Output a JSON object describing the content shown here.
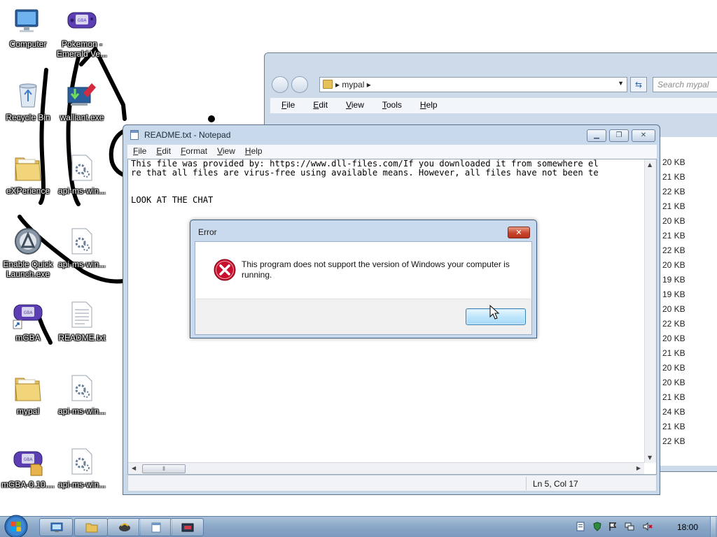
{
  "desktop": {
    "icons": [
      {
        "label": "Computer",
        "icon": "computer-icon"
      },
      {
        "label": "Pokemon - Emerald Ve...",
        "icon": "gba-rom-icon"
      },
      {
        "label": "Recycle Bin",
        "icon": "recycle-bin-icon"
      },
      {
        "label": "walliant.exe",
        "icon": "installer-icon"
      },
      {
        "label": "eXPerience",
        "icon": "folder-icon"
      },
      {
        "label": "api-ms-win...",
        "icon": "dll-file-icon"
      },
      {
        "label": "Enable Quick Launch.exe",
        "icon": "quick-launch-icon"
      },
      {
        "label": "api-ms-win...",
        "icon": "dll-file-icon"
      },
      {
        "label": "mGBA",
        "icon": "mgba-shortcut-icon"
      },
      {
        "label": "README.txt",
        "icon": "text-file-icon"
      },
      {
        "label": "mypal",
        "icon": "folder-icon"
      },
      {
        "label": "api-ms-win...",
        "icon": "dll-file-icon"
      },
      {
        "label": "mGBA-0.10....",
        "icon": "mgba-archive-icon"
      },
      {
        "label": "api-ms-win...",
        "icon": "dll-file-icon"
      }
    ]
  },
  "explorer": {
    "breadcrumb": "mypal",
    "search_placeholder": "Search mypal",
    "menu": [
      "File",
      "Edit",
      "View",
      "Tools",
      "Help"
    ],
    "sizes": [
      "20 KB",
      "21 KB",
      "22 KB",
      "21 KB",
      "20 KB",
      "21 KB",
      "22 KB",
      "20 KB",
      "19 KB",
      "19 KB",
      "20 KB",
      "22 KB",
      "20 KB",
      "21 KB",
      "20 KB",
      "20 KB",
      "21 KB",
      "24 KB",
      "21 KB",
      "22 KB"
    ]
  },
  "notepad": {
    "title": "README.txt - Notepad",
    "menu": [
      "File",
      "Edit",
      "Format",
      "View",
      "Help"
    ],
    "text_line1": "This file was provided by: https://www.dll-files.com/If you downloaded it from somewhere el",
    "text_line2": "re that all files are virus-free using available means. However, all files have not been te",
    "text_line3": "",
    "text_line4": "",
    "text_line5": "LOOK AT THE CHAT",
    "status_position": "Ln 5, Col 17"
  },
  "dialog": {
    "title": "Error",
    "message": "This program does not support the version of Windows your computer is running.",
    "ok_label": ""
  },
  "taskbar": {
    "clock": "18:00"
  },
  "colors": {
    "window_frame": "#c8d9ec",
    "error_red": "#c8102e",
    "taskbar": "#8aa7c7",
    "scribble": "#000000"
  }
}
